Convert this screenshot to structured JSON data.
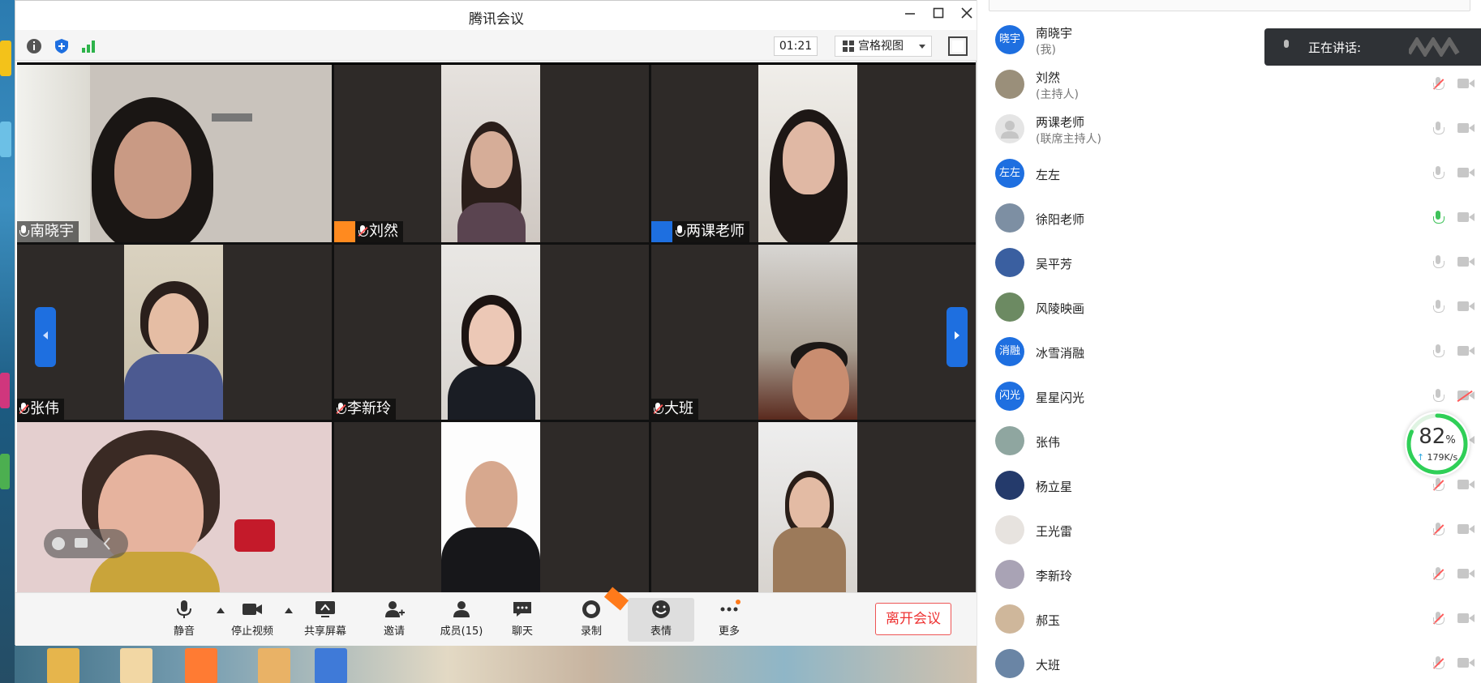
{
  "window": {
    "title": "腾讯会议"
  },
  "toolbar": {
    "timer": "01:21",
    "view_label": "宫格视图"
  },
  "tiles": [
    {
      "name": "南晓宇",
      "role": ""
    },
    {
      "name": "刘然",
      "role": "host"
    },
    {
      "name": "两课老师",
      "role": "cohost"
    },
    {
      "name": "张伟",
      "role": ""
    },
    {
      "name": "李新玲",
      "role": ""
    },
    {
      "name": "大班",
      "role": ""
    }
  ],
  "bottom_bar": {
    "mute": "静音",
    "stop_video": "停止视频",
    "share": "共享屏幕",
    "invite": "邀请",
    "members": "成员(15)",
    "chat": "聊天",
    "record": "录制",
    "reaction": "表情",
    "more": "更多",
    "leave": "离开会议"
  },
  "speaking": {
    "label": "正在讲话:"
  },
  "network": {
    "percent": "82",
    "percent_unit": "%",
    "speed": "179K/s"
  },
  "participants": [
    {
      "name": "南晓宇",
      "sub": "(我)",
      "avatar_text": "晓宇",
      "mic": "none",
      "cam": "none"
    },
    {
      "name": "刘然",
      "sub": "(主持人)",
      "avatar_text": "",
      "mic": "muted",
      "cam": "on"
    },
    {
      "name": "两课老师",
      "sub": "(联席主持人)",
      "avatar_text": "",
      "mic": "on",
      "cam": "on"
    },
    {
      "name": "左左",
      "sub": "",
      "avatar_text": "左左",
      "mic": "on",
      "cam": "on"
    },
    {
      "name": "徐阳老师",
      "sub": "",
      "avatar_text": "",
      "mic": "speaking",
      "cam": "on"
    },
    {
      "name": "吴平芳",
      "sub": "",
      "avatar_text": "",
      "mic": "on",
      "cam": "on"
    },
    {
      "name": "风陵映画",
      "sub": "",
      "avatar_text": "",
      "mic": "on",
      "cam": "on"
    },
    {
      "name": "冰雪消融",
      "sub": "",
      "avatar_text": "消融",
      "mic": "on",
      "cam": "on"
    },
    {
      "name": "星星闪光",
      "sub": "",
      "avatar_text": "闪光",
      "mic": "on",
      "cam": "off"
    },
    {
      "name": "张伟",
      "sub": "",
      "avatar_text": "",
      "mic": "muted",
      "cam": "on"
    },
    {
      "name": "杨立星",
      "sub": "",
      "avatar_text": "",
      "mic": "muted",
      "cam": "on"
    },
    {
      "name": "王光雷",
      "sub": "",
      "avatar_text": "",
      "mic": "muted",
      "cam": "on"
    },
    {
      "name": "李新玲",
      "sub": "",
      "avatar_text": "",
      "mic": "muted",
      "cam": "on"
    },
    {
      "name": "郝玉",
      "sub": "",
      "avatar_text": "",
      "mic": "muted",
      "cam": "on"
    },
    {
      "name": "大班",
      "sub": "",
      "avatar_text": "",
      "mic": "muted",
      "cam": "on"
    }
  ]
}
